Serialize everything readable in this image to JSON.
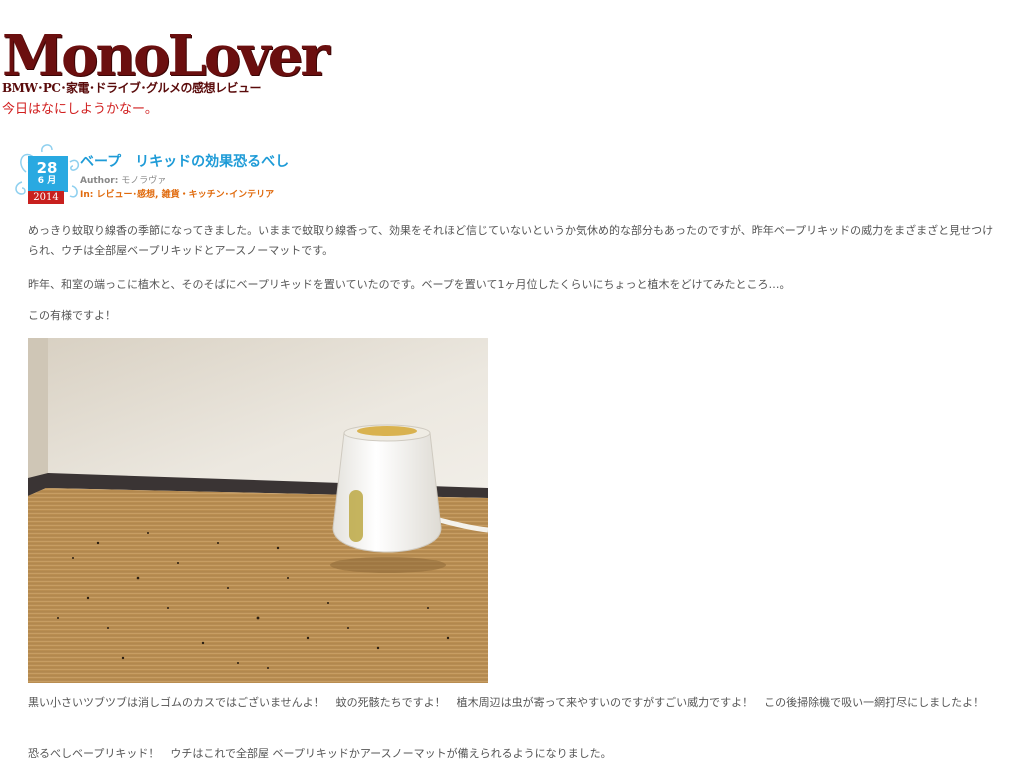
{
  "site": {
    "title": "MonoLover",
    "tagline": "BMW･PC･家電･ドライブ･グルメの感想レビュー",
    "description": "今日はなにしようかなー。"
  },
  "post": {
    "date": {
      "day": "28",
      "month": "6 月",
      "year": "2014"
    },
    "title": "ベープ　リキッドの効果恐るべし",
    "author_label": "Author:",
    "author": "モノラヴァ",
    "categories_label": "In:",
    "categories": [
      "レビュー･感想",
      "雑貨・キッチン･インテリア"
    ],
    "paragraphs": [
      "めっきり蚊取り線香の季節になってきました。いままで蚊取り線香って、効果をそれほど信じていないというか気休め的な部分もあったのですが、昨年ベープリキッドの威力をまざまざと見せつけられ、ウチは全部屋ベープリキッドとアースノーマットです。",
      "昨年、和室の端っこに植木と、そのそばにベープリキッドを置いていたのです。ベープを置いて1ヶ月位したくらいにちょっと植木をどけてみたところ…。",
      "この有様ですよ！",
      "黒い小さいツブツブは消しゴムのカスではございませんよ！　蚊の死骸たちですよ！　植木周辺は虫が寄って来やすいのですがすごい威力ですよ！　この後掃除機で吸い一網打尽にしましたよ！",
      "恐るべしベープリキッド！　ウチはこれで全部屋 ベープリキッドかアースノーマットが備えられるようになりました。"
    ]
  },
  "colors": {
    "logo": "#6b0f0f",
    "description": "#d11f1f",
    "post_title": "#1e9bd7",
    "categories": "#e06a0c",
    "date_badge": "#29a9e1",
    "year_badge": "#c8201e"
  },
  "icons": {
    "date_badge": "swirl-calendar-icon"
  }
}
